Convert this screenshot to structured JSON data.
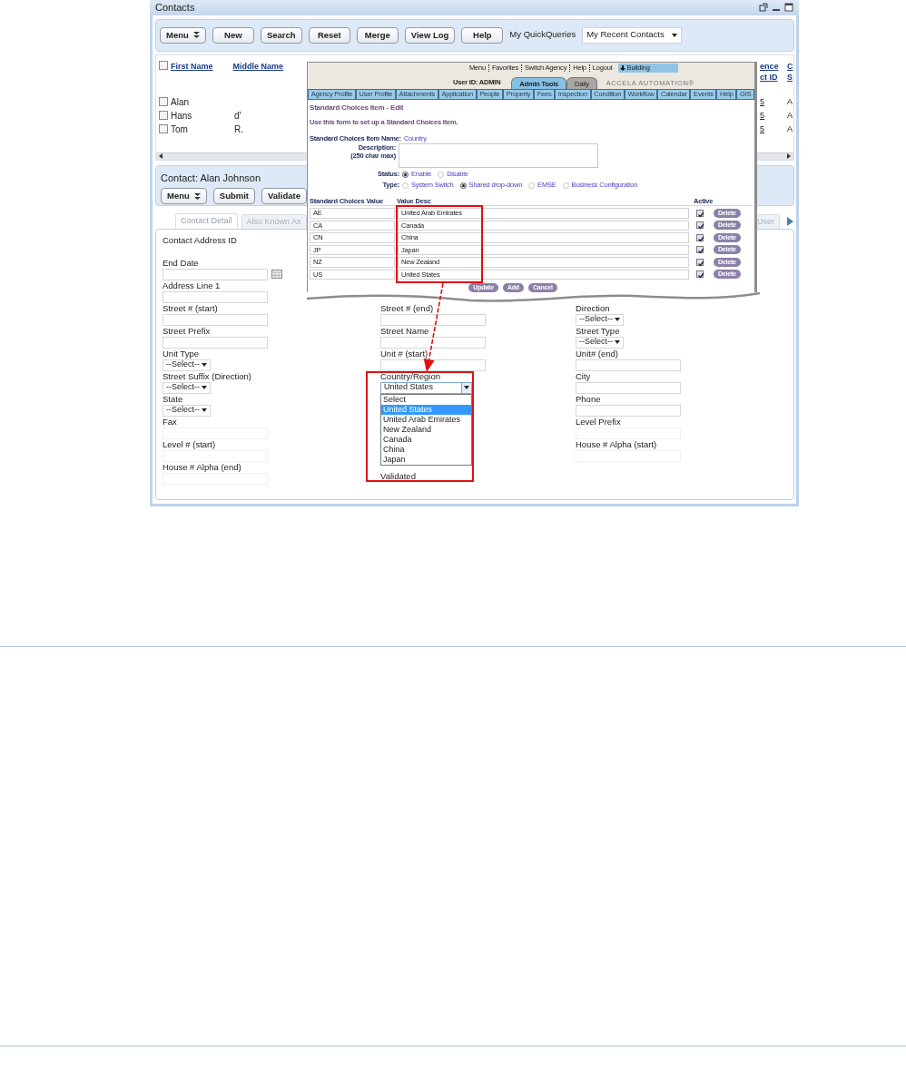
{
  "window": {
    "title": "Contacts"
  },
  "toolbar": {
    "buttons": [
      {
        "label": "Menu",
        "kind": "menu"
      },
      {
        "label": "New",
        "kind": "plain"
      },
      {
        "label": "Search",
        "kind": "plain"
      },
      {
        "label": "Reset",
        "kind": "plain"
      },
      {
        "label": "Merge",
        "kind": "plain"
      },
      {
        "label": "View Log",
        "kind": "plain"
      },
      {
        "label": "Help",
        "kind": "plain"
      }
    ],
    "quick_queries": {
      "label": "My QuickQueries",
      "value": "My Recent Contacts"
    }
  },
  "grid": {
    "header_checked": false,
    "columns": [
      "First Name",
      "Middle Name"
    ],
    "cut_columns": [
      {
        "line_1": "ence",
        "line_2": "ct ID"
      },
      {
        "line_1": "C",
        "line_2": "S"
      }
    ],
    "rows": [
      {
        "checked": false,
        "first_name": "Alan",
        "column_3": "5",
        "column_4": "A"
      },
      {
        "checked": false,
        "first_name": "Hans",
        "middle_name": "d'",
        "column_3": "5",
        "column_4": "A"
      },
      {
        "checked": false,
        "first_name": "Tom",
        "middle_name": "R.",
        "column_3": "5",
        "column_4": "A"
      }
    ]
  },
  "contact_panel": {
    "title": "Contact: Alan Johnson",
    "buttons": [
      {
        "label": "Menu",
        "kind": "menu"
      },
      {
        "label": "Submit",
        "kind": "plain"
      },
      {
        "label": "Validate",
        "kind": "plain"
      }
    ]
  },
  "tabs": [
    {
      "label": "Contact Detail",
      "selected": true
    },
    {
      "label": "Also Known As",
      "selected": false
    },
    {
      "label": "User",
      "selected": false
    }
  ],
  "form": {
    "columns": [
      [
        {
          "label": "Contact Address ID",
          "kind": "readonly"
        },
        {
          "label": "End Date",
          "kind": "date"
        },
        {
          "label": "Address Line 1",
          "kind": "text"
        },
        {
          "label": "Street # (start)",
          "kind": "text"
        },
        {
          "label": "Street Prefix",
          "kind": "text"
        },
        {
          "label": "Unit Type",
          "kind": "select",
          "value": "--Select--"
        },
        {
          "label": "Street Suffix (Direction)",
          "kind": "select",
          "value": "--Select--"
        },
        {
          "label": "State",
          "kind": "select",
          "value": "--Select--"
        },
        {
          "label": "Fax",
          "kind": "faint"
        },
        {
          "label": "Level # (start)",
          "kind": "faint"
        },
        {
          "label": "House # Alpha (end)",
          "kind": "faint"
        }
      ],
      [
        {
          "label": "Street # (end)",
          "kind": "text"
        },
        {
          "label": "Street Name",
          "kind": "text"
        },
        {
          "label": "Unit # (start)",
          "kind": "text"
        },
        {
          "label": "Country/Region",
          "kind": "dropdown",
          "value": "United States",
          "options": [
            {
              "label": "Select",
              "selected": false
            },
            {
              "label": "United States",
              "selected": true
            },
            {
              "label": "United Arab Emirates",
              "selected": false
            },
            {
              "label": "New Zealand",
              "selected": false
            },
            {
              "label": "Canada",
              "selected": false
            },
            {
              "label": "China",
              "selected": false
            },
            {
              "label": "Japan",
              "selected": false
            }
          ]
        },
        {
          "label": "Validated",
          "kind": "readonly"
        }
      ],
      [
        {
          "label": "Direction",
          "kind": "select",
          "value": "--Select--"
        },
        {
          "label": "Street Type",
          "kind": "select",
          "value": "--Select--"
        },
        {
          "label": "Unit# (end)",
          "kind": "text"
        },
        {
          "label": "City",
          "kind": "text"
        },
        {
          "label": "Phone",
          "kind": "text"
        },
        {
          "label": "Level Prefix",
          "kind": "faint"
        },
        {
          "label": "House # Alpha (start)",
          "kind": "faint"
        }
      ]
    ]
  },
  "inset": {
    "top_links": [
      "Menu",
      "Favorites",
      "Switch Agency",
      "Help",
      "Logout"
    ],
    "module": "Building",
    "user_id": "User ID: ADMIN",
    "tabs": [
      {
        "label": "Admin Tools",
        "selected": true
      },
      {
        "label": "Daily",
        "selected": false
      }
    ],
    "brand": "ACCELA AUTOMATION®",
    "nav": [
      "Agency Profile",
      "User Profile",
      "Attachments",
      "Application",
      "People",
      "Property",
      "Fees",
      "Inspection",
      "Condition",
      "Workflow",
      "Calendar",
      "Events",
      "Help",
      "GIS"
    ],
    "heading": "Standard Choices Item - Edit",
    "instruction": "Use this form to set up a Standard Choices Item.",
    "item_name": {
      "label": "Standard Choices Item Name:",
      "value": "Country"
    },
    "description": {
      "label": "Description:",
      "hint": "(250 char max)"
    },
    "status": {
      "label": "Status:",
      "options": [
        {
          "label": "Enable",
          "selected": true
        },
        {
          "label": "Disable",
          "selected": false
        }
      ]
    },
    "type": {
      "label": "Type:",
      "options": [
        {
          "label": "System Switch",
          "selected": false
        },
        {
          "label": "Shared drop-down",
          "selected": true
        },
        {
          "label": "EMSE",
          "selected": false
        },
        {
          "label": "Business Configuration",
          "selected": false
        }
      ]
    },
    "table": {
      "columns": [
        "Standard Choices Value",
        "Value Desc",
        "Active"
      ],
      "rows": [
        {
          "value": "AE",
          "desc": "United Arab Emirates",
          "active": true,
          "action": "Delete"
        },
        {
          "value": "CA",
          "desc": "Canada",
          "active": true,
          "action": "Delete"
        },
        {
          "value": "CN",
          "desc": "China",
          "active": true,
          "action": "Delete"
        },
        {
          "value": "JP",
          "desc": "Japan",
          "active": true,
          "action": "Delete"
        },
        {
          "value": "NZ",
          "desc": "New Zealand",
          "active": true,
          "action": "Delete"
        },
        {
          "value": "US",
          "desc": "United States",
          "active": true,
          "action": "Delete"
        }
      ]
    },
    "buttons": [
      "Update",
      "Add",
      "Cancel"
    ]
  }
}
